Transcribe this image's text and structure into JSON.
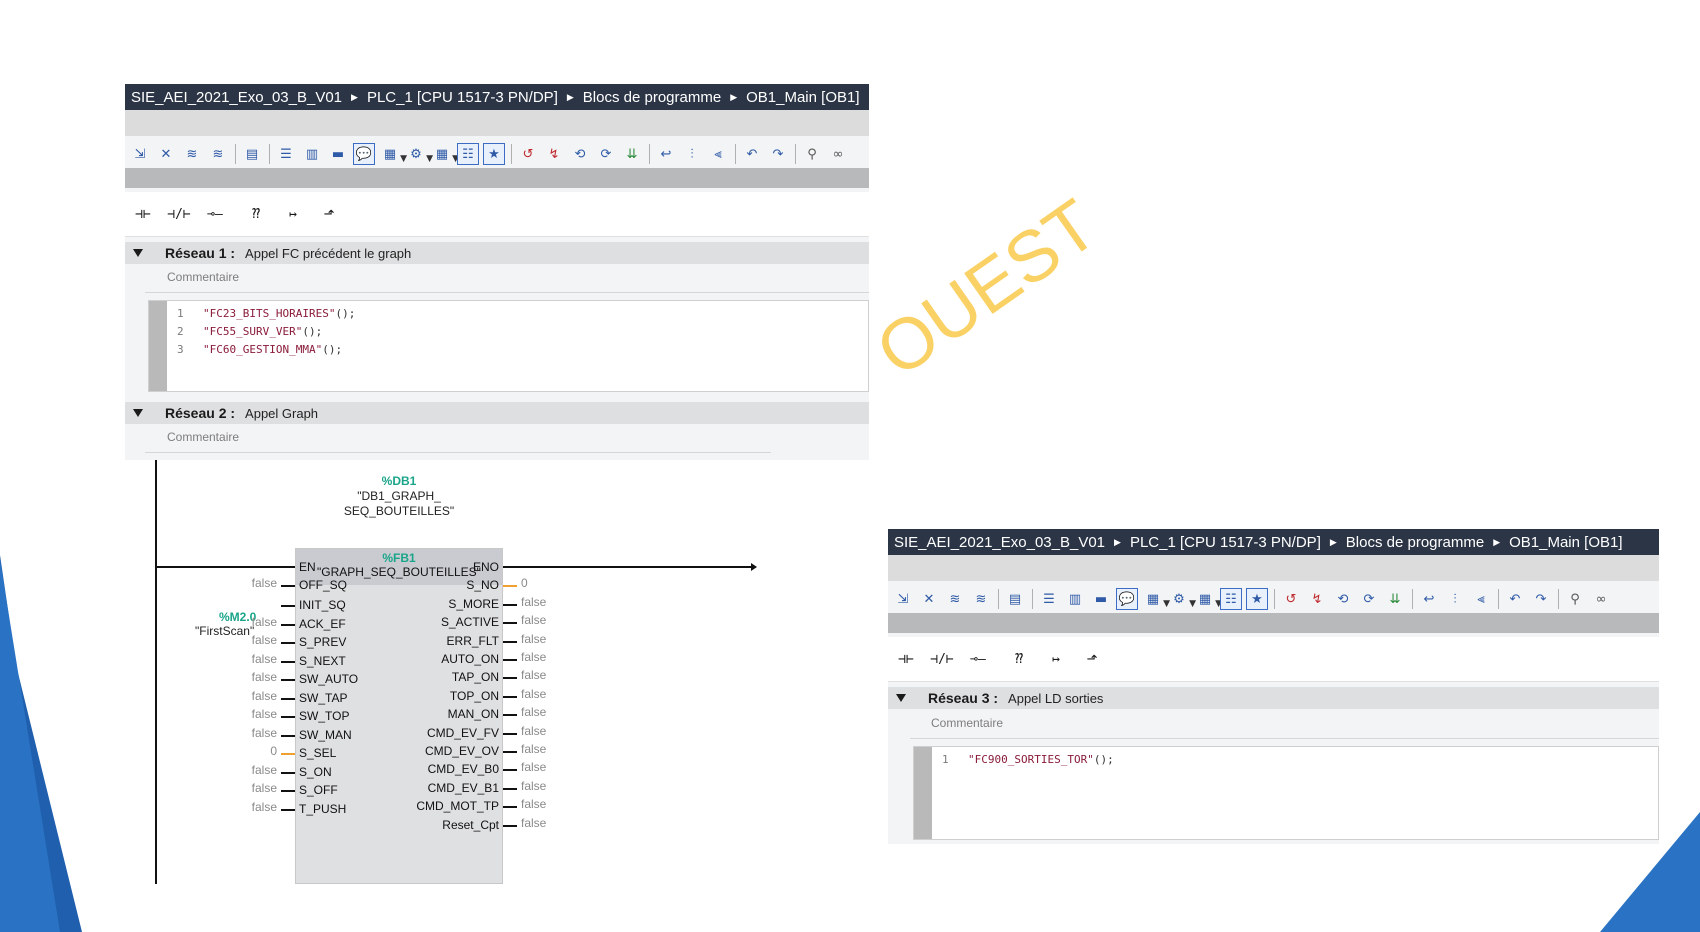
{
  "colors": {
    "breadcrumb_bg": "#2c3546",
    "accent_blue": "#1d5bb8",
    "watermark": "#f8c94a",
    "green_label": "#1aa58a",
    "code_string": "#8a1b3a"
  },
  "watermark": "OUEST",
  "breadcrumb": [
    "SIE_AEI_2021_Exo_03_B_V01",
    "PLC_1 [CPU 1517-3 PN/DP]",
    "Blocs de programme",
    "OB1_Main [OB1]"
  ],
  "toolbar_icons": [
    "insert-network-icon",
    "delete-network-icon",
    "insert-row-icon",
    "add-row-icon",
    "delete-icon",
    "expand-all-icon",
    "collapse-all-icon",
    "show-favorites-icon",
    "comments-icon",
    "abs-symbolic-icon",
    "display-operand-icon",
    "monitor-icon",
    "list-icon",
    "favorites-edit-icon",
    "goto-error-icon",
    "goto-prev-icon",
    "goto-next-icon",
    "compare-icon",
    "copy-icon",
    "step-icon",
    "indent-icon",
    "outdent-icon",
    "tree-icon",
    "undo-icon",
    "redo-icon",
    "monitor-on-icon",
    "glasses-icon"
  ],
  "ladder_buttons": [
    "⊣⊢",
    "⊣/⊢",
    "⊸—",
    "⁇",
    "↦",
    "⬏"
  ],
  "window1": {
    "networks": [
      {
        "title": "Réseau 1 :",
        "desc": "Appel FC précédent le graph",
        "comment": "Commentaire",
        "code": [
          {
            "n": "1",
            "s": "\"FC23_BITS_HORAIRES\"",
            "p": "();"
          },
          {
            "n": "2",
            "s": "\"FC55_SURV_VER\"",
            "p": "();"
          },
          {
            "n": "3",
            "s": "\"FC60_GESTION_MMA\"",
            "p": "();"
          }
        ]
      },
      {
        "title": "Réseau 2 :",
        "desc": "Appel Graph",
        "comment": "Commentaire"
      }
    ],
    "fbd": {
      "db_addr": "%DB1",
      "db_name_1": "\"DB1_GRAPH_",
      "db_name_2": "SEQ_BOUTEILLES\"",
      "fb_addr": "%FB1",
      "fb_name": "\"GRAPH_SEQ_BOUTEILLES\"",
      "m_addr": "%M2.0",
      "m_name": "\"FirstScan\"",
      "inputs": [
        {
          "pin": "EN",
          "val": ""
        },
        {
          "pin": "OFF_SQ",
          "val": "false"
        },
        {
          "pin": "INIT_SQ",
          "val": ""
        },
        {
          "pin": "ACK_EF",
          "val": "false"
        },
        {
          "pin": "S_PREV",
          "val": "false"
        },
        {
          "pin": "S_NEXT",
          "val": "false"
        },
        {
          "pin": "SW_AUTO",
          "val": "false"
        },
        {
          "pin": "SW_TAP",
          "val": "false"
        },
        {
          "pin": "SW_TOP",
          "val": "false"
        },
        {
          "pin": "SW_MAN",
          "val": "false"
        },
        {
          "pin": "S_SEL",
          "val": "0"
        },
        {
          "pin": "S_ON",
          "val": "false"
        },
        {
          "pin": "S_OFF",
          "val": "false"
        },
        {
          "pin": "T_PUSH",
          "val": "false"
        }
      ],
      "outputs": [
        {
          "pin": "ENO",
          "val": ""
        },
        {
          "pin": "S_NO",
          "val": "0"
        },
        {
          "pin": "S_MORE",
          "val": "false"
        },
        {
          "pin": "S_ACTIVE",
          "val": "false"
        },
        {
          "pin": "ERR_FLT",
          "val": "false"
        },
        {
          "pin": "AUTO_ON",
          "val": "false"
        },
        {
          "pin": "TAP_ON",
          "val": "false"
        },
        {
          "pin": "TOP_ON",
          "val": "false"
        },
        {
          "pin": "MAN_ON",
          "val": "false"
        },
        {
          "pin": "CMD_EV_FV",
          "val": "false"
        },
        {
          "pin": "CMD_EV_OV",
          "val": "false"
        },
        {
          "pin": "CMD_EV_B0",
          "val": "false"
        },
        {
          "pin": "CMD_EV_B1",
          "val": "false"
        },
        {
          "pin": "CMD_MOT_TP",
          "val": "false"
        },
        {
          "pin": "Reset_Cpt",
          "val": "false"
        }
      ]
    }
  },
  "window2": {
    "networks": [
      {
        "title": "Réseau 3 :",
        "desc": "Appel LD sorties",
        "comment": "Commentaire",
        "code": [
          {
            "n": "1",
            "s": "\"FC900_SORTIES_TOR\"",
            "p": "();"
          }
        ]
      }
    ]
  }
}
